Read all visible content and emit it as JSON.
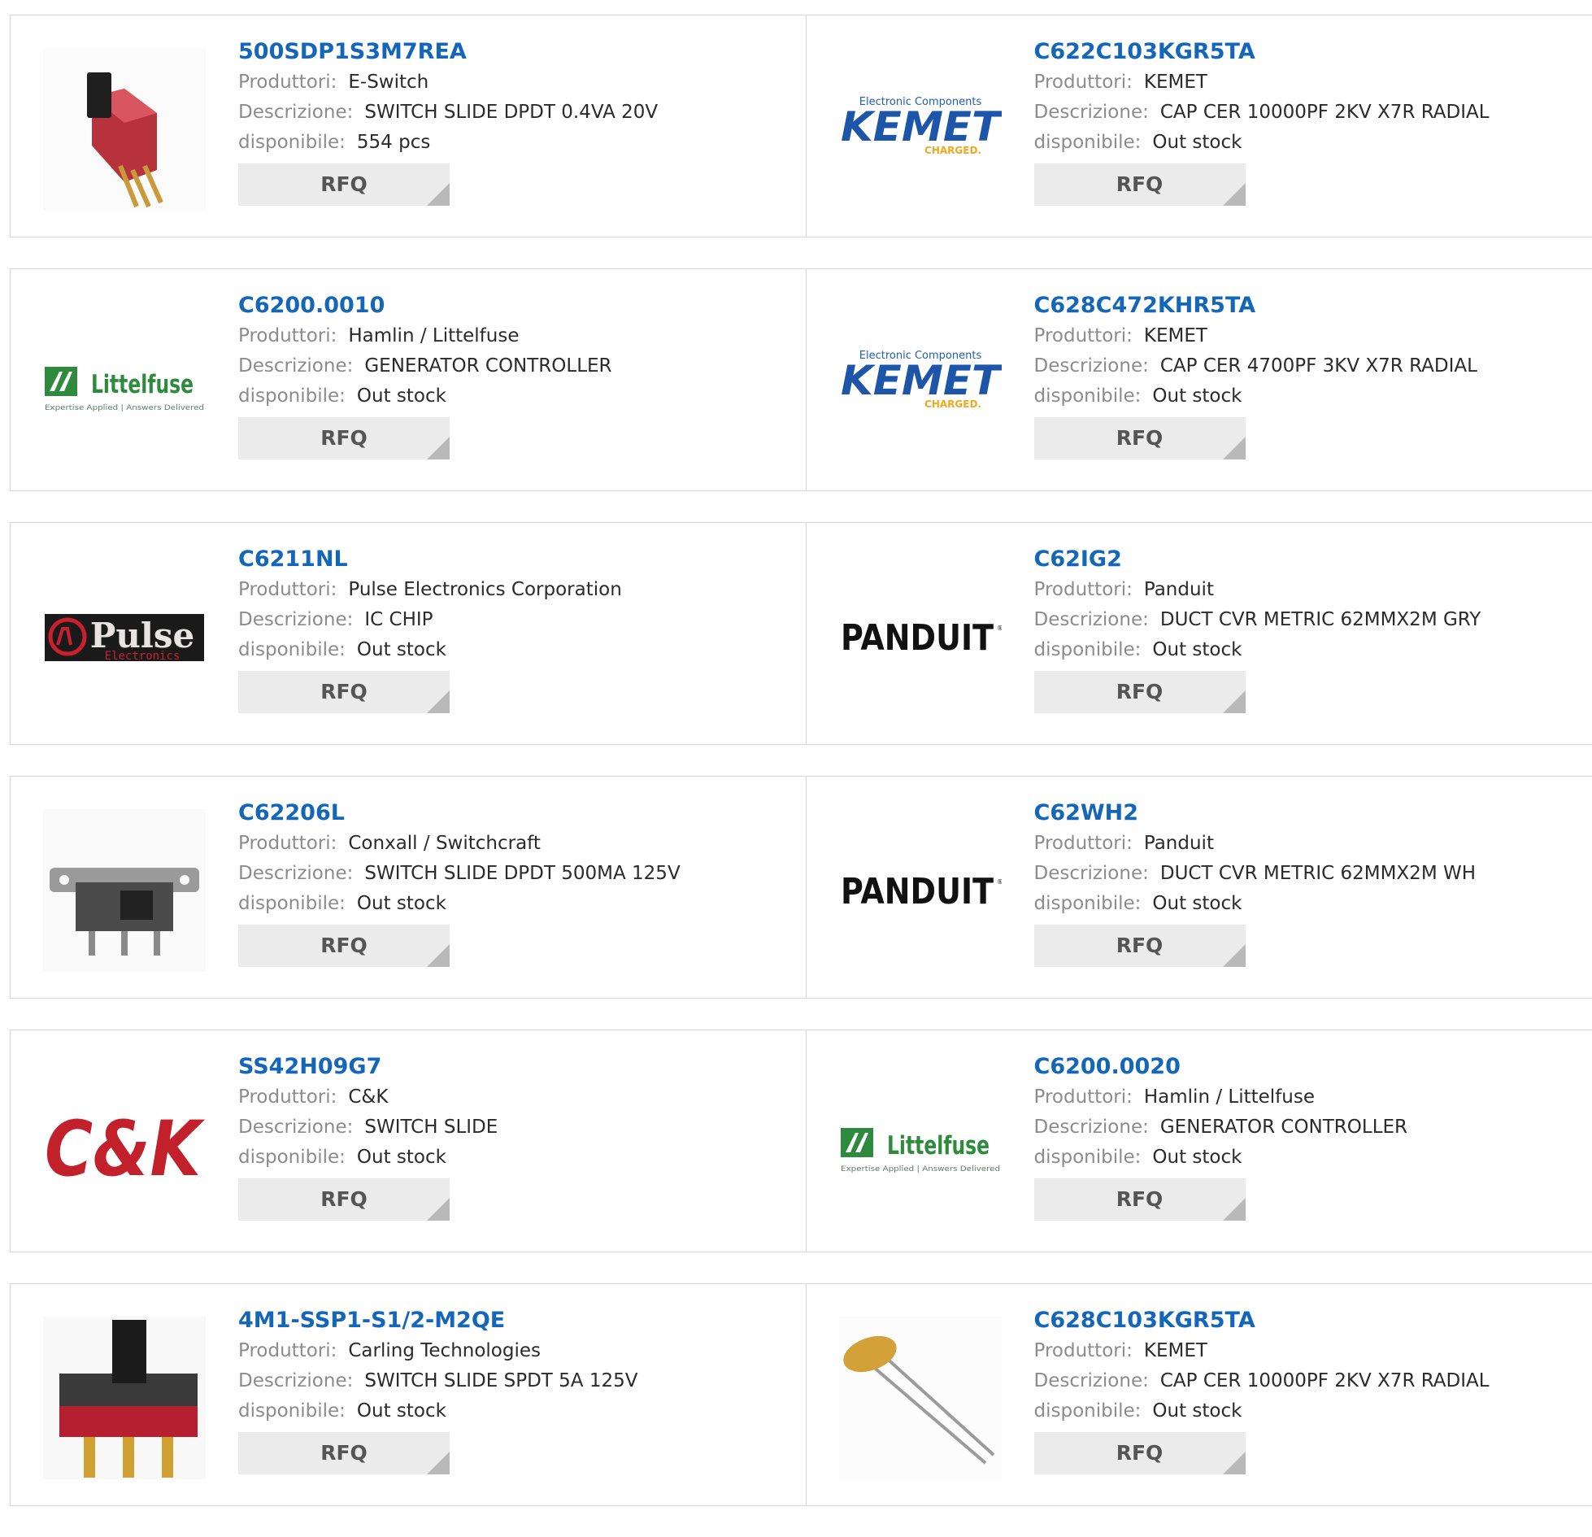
{
  "labels": {
    "manufacturer": "Produttori:",
    "description": "Descrizione:",
    "availability": "disponibile:",
    "rfq": "RFQ"
  },
  "logos": {
    "kemet": {
      "top": "Electronic Components",
      "main": "KEMET",
      "tag": "CHARGED."
    },
    "littelfuse": {
      "main": "Littelfuse",
      "tag": "Expertise Applied | Answers Delivered"
    },
    "pulse": {
      "main": "Pulse",
      "sub": "Electronics"
    },
    "panduit": {
      "main": "PANDUIT"
    },
    "ck": {
      "main": "C&K"
    }
  },
  "products": [
    {
      "pn": "500SDP1S3M7REA",
      "manufacturer": "E-Switch",
      "description": "SWITCH SLIDE DPDT 0.4VA 20V",
      "availability": "554 pcs",
      "image": "slide-switch-red-photo"
    },
    {
      "pn": "C622C103KGR5TA",
      "manufacturer": "KEMET",
      "description": "CAP CER 10000PF 2KV X7R RADIAL",
      "availability": "Out stock",
      "image": "kemet-logo"
    },
    {
      "pn": "C6200.0010",
      "manufacturer": "Hamlin / Littelfuse",
      "description": "GENERATOR CONTROLLER",
      "availability": "Out stock",
      "image": "littelfuse-logo"
    },
    {
      "pn": "C628C472KHR5TA",
      "manufacturer": "KEMET",
      "description": "CAP CER 4700PF 3KV X7R RADIAL",
      "availability": "Out stock",
      "image": "kemet-logo"
    },
    {
      "pn": "C6211NL",
      "manufacturer": "Pulse Electronics Corporation",
      "description": "IC CHIP",
      "availability": "Out stock",
      "image": "pulse-logo"
    },
    {
      "pn": "C62IG2",
      "manufacturer": "Panduit",
      "description": "DUCT CVR METRIC 62MMX2M GRY",
      "availability": "Out stock",
      "image": "panduit-logo"
    },
    {
      "pn": "C62206L",
      "manufacturer": "Conxall / Switchcraft",
      "description": "SWITCH SLIDE DPDT 500MA 125V",
      "availability": "Out stock",
      "image": "slide-switch-metal-photo"
    },
    {
      "pn": "C62WH2",
      "manufacturer": "Panduit",
      "description": "DUCT CVR METRIC 62MMX2M WH",
      "availability": "Out stock",
      "image": "panduit-logo"
    },
    {
      "pn": "SS42H09G7",
      "manufacturer": "C&K",
      "description": "SWITCH SLIDE",
      "availability": "Out stock",
      "image": "ck-logo"
    },
    {
      "pn": "C6200.0020",
      "manufacturer": "Hamlin / Littelfuse",
      "description": "GENERATOR CONTROLLER",
      "availability": "Out stock",
      "image": "littelfuse-logo"
    },
    {
      "pn": "4M1-SSP1-S1/2-M2QE",
      "manufacturer": "Carling Technologies",
      "description": "SWITCH SLIDE SPDT 5A 125V",
      "availability": "Out stock",
      "image": "slide-switch-black-red-photo"
    },
    {
      "pn": "C628C103KGR5TA",
      "manufacturer": "KEMET",
      "description": "CAP CER 10000PF 2KV X7R RADIAL",
      "availability": "Out stock",
      "image": "ceramic-capacitor-photo"
    }
  ]
}
